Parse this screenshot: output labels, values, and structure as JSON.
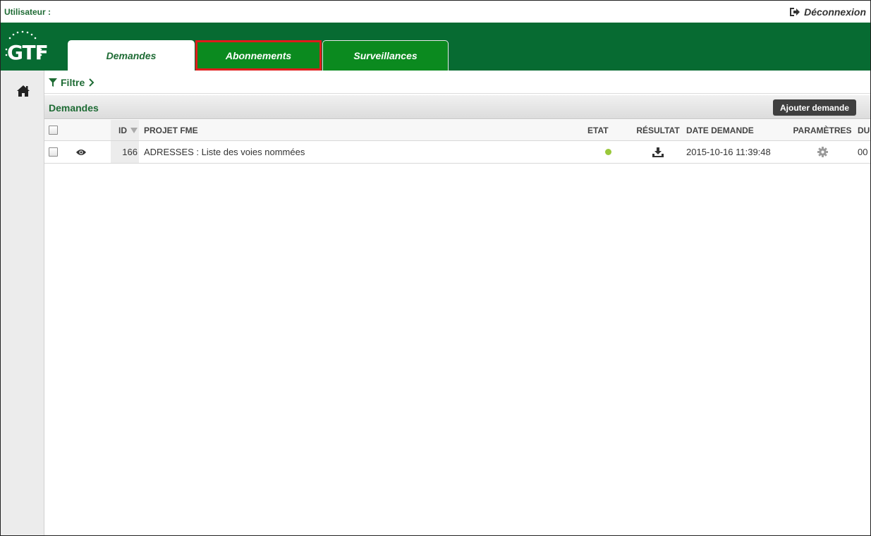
{
  "userbar": {
    "user_label": "Utilisateur :",
    "logout_label": "Déconnexion"
  },
  "header": {
    "logo_text": "GTF",
    "tabs": [
      {
        "label": "Demandes",
        "state": "active"
      },
      {
        "label": "Abonnements",
        "state": "highlighted"
      },
      {
        "label": "Surveillances",
        "state": "normal"
      }
    ]
  },
  "filter": {
    "label": "Filtre"
  },
  "panel": {
    "title": "Demandes",
    "add_button": "Ajouter demande"
  },
  "table": {
    "headers": {
      "id": "ID",
      "projet": "PROJET FME",
      "etat": "ETAT",
      "resultat": "RÉSULTAT",
      "date": "DATE DEMANDE",
      "parametres": "PARAMÈTRES",
      "du": "DU"
    },
    "rows": [
      {
        "id": "166",
        "projet": "ADRESSES : Liste des voies nommées",
        "etat_color": "#9ac83b",
        "date": "2015-10-16 11:39:48",
        "du": "00"
      }
    ]
  },
  "colors": {
    "brand_green": "#076b32",
    "tab_green": "#0b8a1f",
    "highlight_red": "#e01b1b"
  }
}
